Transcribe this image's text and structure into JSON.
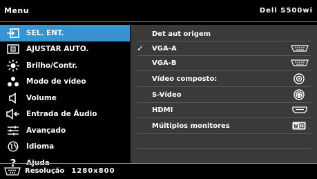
{
  "header": {
    "title": "Menu",
    "model": "Dell S500wi"
  },
  "sidebar": {
    "items": [
      {
        "label": "SEL. ENT.",
        "icon": "input-select-icon",
        "active": true
      },
      {
        "label": "AJUSTAR AUTO.",
        "icon": "auto-adjust-icon"
      },
      {
        "label": "Brilho/Contr.",
        "icon": "brightness-icon"
      },
      {
        "label": "Modo de vídeo",
        "icon": "video-mode-icon"
      },
      {
        "label": "Volume",
        "icon": "speaker-icon"
      },
      {
        "label": "Entrada de Áudio",
        "icon": "audio-input-icon"
      },
      {
        "label": "Avançado",
        "icon": "advanced-sliders-icon"
      },
      {
        "label": "Idioma",
        "icon": "globe-icon"
      },
      {
        "label": "Ajuda",
        "icon": "question-icon"
      }
    ]
  },
  "panel": {
    "items": [
      {
        "label": "Det aut origem",
        "icon": "",
        "checked": false
      },
      {
        "label": "VGA-A",
        "icon": "vga-port-icon",
        "checked": true
      },
      {
        "label": "VGA-B",
        "icon": "vga-port-icon",
        "checked": false
      },
      {
        "label": "Vídeo composto:",
        "icon": "composite-port-icon",
        "checked": false
      },
      {
        "label": "S-Vídeo",
        "icon": "s-video-port-icon",
        "checked": false
      },
      {
        "label": "HDMI",
        "icon": "hdmi-port-icon",
        "checked": false
      },
      {
        "label": "Múltiplos monitores",
        "icon": "multi-display-icon",
        "checked": false
      }
    ],
    "check_glyph": "✓"
  },
  "footer": {
    "label": "Resolução",
    "value": "1280x800",
    "icon": "vga-port-icon"
  },
  "colors": {
    "accent": "#3a93d1",
    "panel_bg": "#3a3a3a",
    "background": "#000000"
  }
}
